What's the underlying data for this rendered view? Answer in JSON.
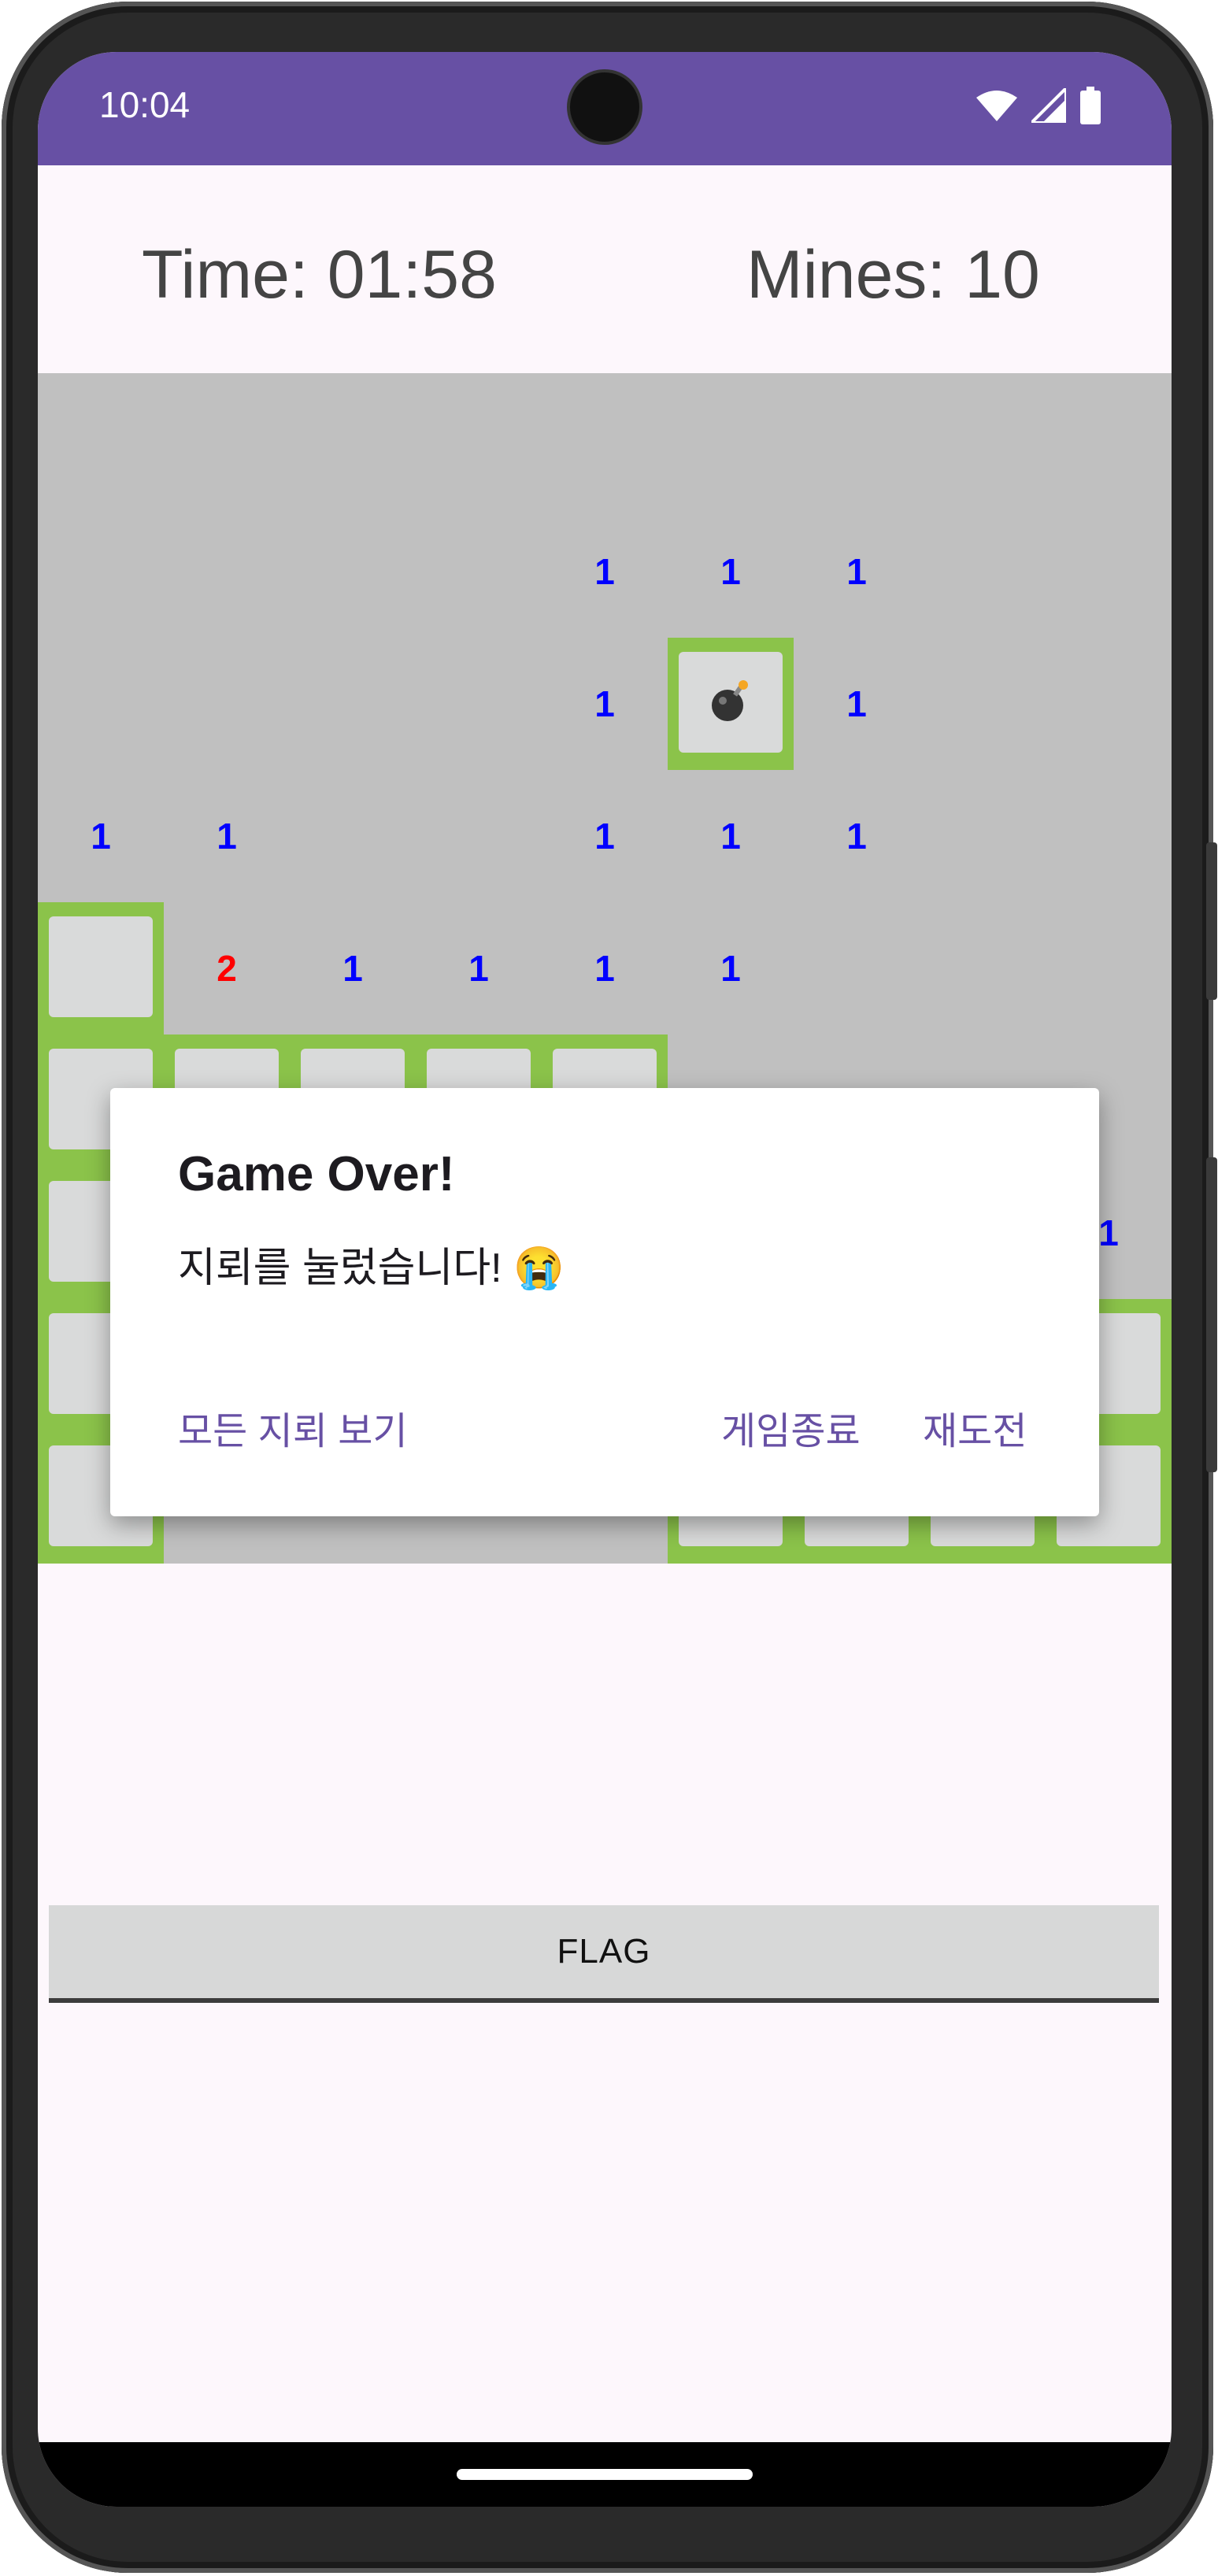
{
  "status_bar": {
    "time": "10:04",
    "icons": [
      "wifi-icon",
      "signal-icon",
      "battery-icon"
    ]
  },
  "header": {
    "time_label": "Time: 01:58",
    "mines_label": "Mines: 10"
  },
  "board": {
    "rows": [
      [
        "",
        "",
        "",
        "",
        "",
        "",
        "",
        "",
        ""
      ],
      [
        "",
        "",
        "",
        "",
        "1",
        "1",
        "1",
        "",
        ""
      ],
      [
        "",
        "",
        "",
        "",
        "1",
        "mine",
        "1",
        "",
        ""
      ],
      [
        "1",
        "1",
        "",
        "",
        "1",
        "1",
        "1",
        "",
        ""
      ],
      [
        "H",
        "2",
        "1",
        "1",
        "1",
        "1",
        "",
        "",
        ""
      ],
      [
        "H",
        "H",
        "H",
        "H",
        "H",
        "",
        "",
        "",
        ""
      ],
      [
        "H",
        "",
        "",
        "",
        "",
        "",
        "",
        "",
        "1"
      ],
      [
        "H",
        "",
        "",
        "",
        "",
        "H",
        "H",
        "H",
        "H"
      ],
      [
        "H",
        "",
        "",
        "",
        "",
        "H",
        "H",
        "H",
        "H"
      ]
    ]
  },
  "dialog": {
    "title": "Game Over!",
    "message": "지뢰를 눌렀습니다! 😭",
    "show_mines_label": "모든 지뢰 보기",
    "quit_label": "게임종료",
    "retry_label": "재도전"
  },
  "flag_button": {
    "label": "FLAG"
  },
  "colors": {
    "accent": "#6750a4",
    "hidden_border": "#8bc34a",
    "board_bg": "#c0c0c0",
    "one": "#0000ff",
    "two": "#ff0000"
  }
}
